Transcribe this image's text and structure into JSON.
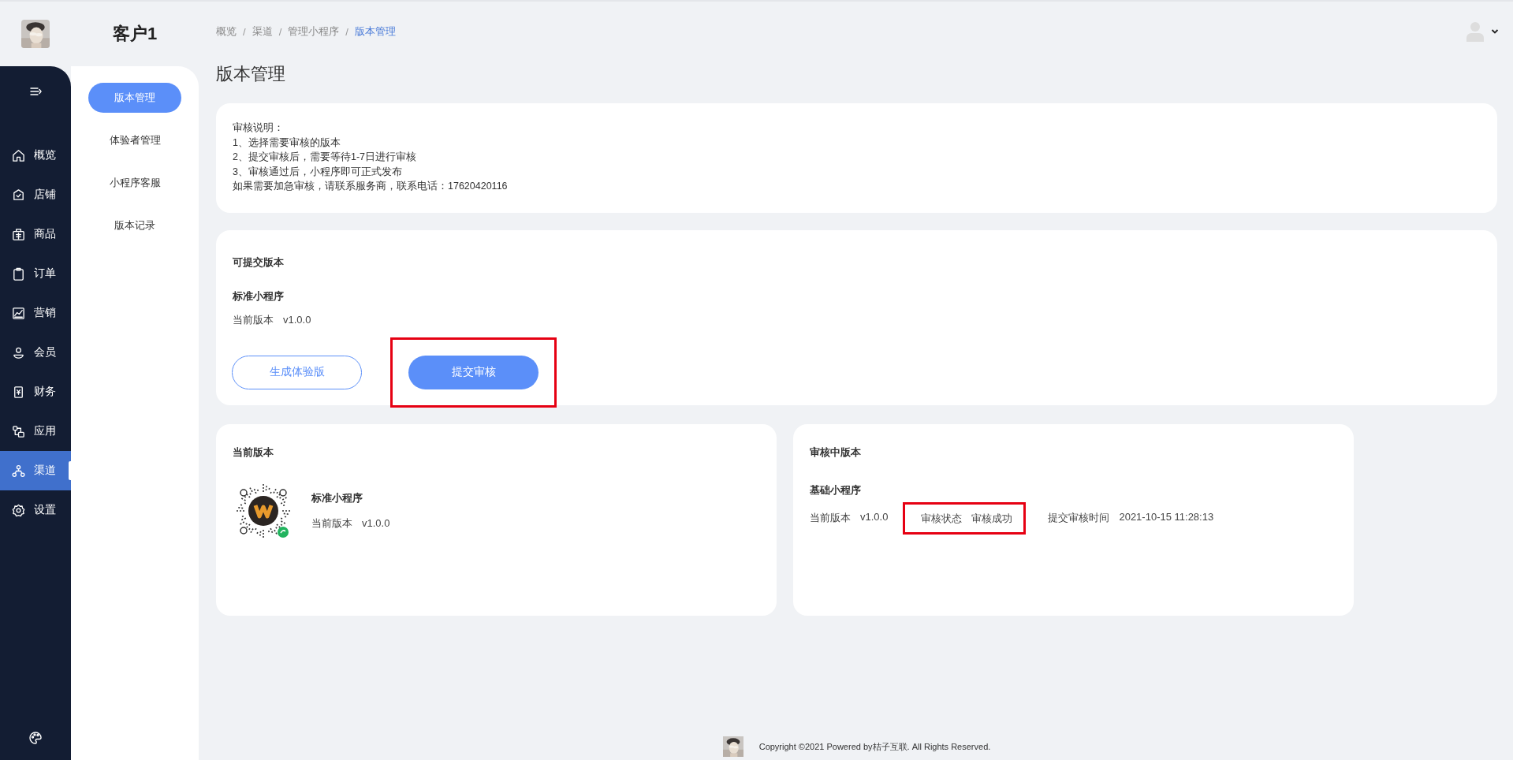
{
  "brand": {
    "title": "客户1"
  },
  "nav": [
    {
      "label": "概览",
      "selected": false
    },
    {
      "label": "店铺",
      "selected": false
    },
    {
      "label": "商品",
      "selected": false
    },
    {
      "label": "订单",
      "selected": false
    },
    {
      "label": "营销",
      "selected": false
    },
    {
      "label": "会员",
      "selected": false
    },
    {
      "label": "财务",
      "selected": false
    },
    {
      "label": "应用",
      "selected": false
    },
    {
      "label": "渠道",
      "selected": true
    },
    {
      "label": "设置",
      "selected": false
    }
  ],
  "subnav": [
    {
      "label": "版本管理",
      "selected": true
    },
    {
      "label": "体验者管理",
      "selected": false
    },
    {
      "label": "小程序客服",
      "selected": false
    },
    {
      "label": "版本记录",
      "selected": false
    }
  ],
  "breadcrumb": [
    {
      "label": "概览",
      "current": false
    },
    {
      "separator": "/",
      "label": "渠道",
      "current": false
    },
    {
      "separator": "/",
      "label": "管理小程序",
      "current": false
    },
    {
      "separator": "/",
      "label": "版本管理",
      "current": true
    }
  ],
  "page_title": "版本管理",
  "notice": {
    "lines": [
      "审核说明：",
      "1、选择需要审核的版本",
      "2、提交审核后，需要等待1-7日进行审核",
      "3、审核通过后，小程序即可正式发布",
      "如果需要加急审核，请联系服务商，联系电话：17620420116"
    ]
  },
  "submittable": {
    "title": "可提交版本",
    "app_name": "标准小程序",
    "version_label": "当前版本",
    "version": "v1.0.0",
    "buttons": [
      {
        "label": "生成体验版",
        "kind": "outline",
        "highlighted": false
      },
      {
        "label": "提交审核",
        "kind": "primary",
        "highlighted": true
      }
    ]
  },
  "current": {
    "title": "当前版本",
    "app_name": "标准小程序",
    "version_label": "当前版本",
    "version": "v1.0.0"
  },
  "reviewing": {
    "title": "审核中版本",
    "app_name": "基础小程序",
    "version_label": "当前版本",
    "version": "v1.0.0",
    "status_label": "审核状态",
    "status": "审核成功",
    "status_highlighted": true,
    "time_label": "提交审核时间",
    "time": "2021-10-15 11:28:13"
  },
  "footer": {
    "text": "Copyright ©2021 Powered by桔子互联. All Rights Reserved."
  }
}
